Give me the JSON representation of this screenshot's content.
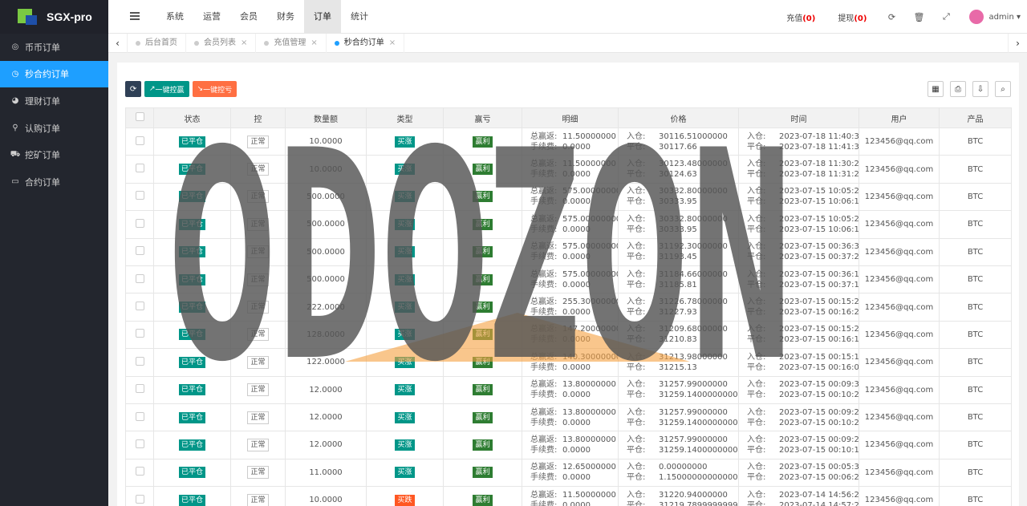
{
  "app": {
    "brand": "SGX-pro"
  },
  "sidebar": {
    "items": [
      {
        "label": "币币订单",
        "icon": "coin-icon"
      },
      {
        "label": "秒合约订单",
        "icon": "clock-icon",
        "active": true
      },
      {
        "label": "理财订单",
        "icon": "pie-icon"
      },
      {
        "label": "认购订单",
        "icon": "walk-icon"
      },
      {
        "label": "挖矿订单",
        "icon": "car-icon"
      },
      {
        "label": "合约订单",
        "icon": "monitor-icon"
      }
    ]
  },
  "header": {
    "menu": [
      "系统",
      "运营",
      "会员",
      "财务",
      "订单",
      "统计"
    ],
    "active_menu": "订单",
    "recharge_label": "充值",
    "recharge_count": "(0)",
    "withdraw_label": "提现",
    "withdraw_count": "(0)",
    "user": "admin"
  },
  "tabs": [
    {
      "label": "后台首页",
      "closable": false
    },
    {
      "label": "会员列表",
      "closable": true
    },
    {
      "label": "充值管理",
      "closable": true
    },
    {
      "label": "秒合约订单",
      "closable": true,
      "active": true
    }
  ],
  "toolbar": {
    "refresh_icon": "⟳",
    "win_label": "一键控赢",
    "lose_label": "一键控亏"
  },
  "table": {
    "columns": [
      "状态",
      "控",
      "数量额",
      "类型",
      "赢亏",
      "明细",
      "价格",
      "时间",
      "用户",
      "产品"
    ],
    "detail_keys": {
      "profit": "总赢返:",
      "fee": "手续费:"
    },
    "price_keys": {
      "in": "入仓:",
      "out": "平仓:"
    },
    "time_keys": {
      "in": "入仓:",
      "out": "平仓:"
    },
    "rows": [
      {
        "status": "已平仓",
        "ctrl": "正常",
        "amount": "10.0000",
        "type": "买涨",
        "result": "赢利",
        "profit": "11.50000000",
        "fee": "0.0000",
        "in_price": "30116.51000000",
        "out_price": "30117.66",
        "in_time": "2023-07-18 11:40:32",
        "out_time": "2023-07-18 11:41:35",
        "user": "123456@qq.com",
        "product": "BTC"
      },
      {
        "status": "已平仓",
        "ctrl": "正常",
        "amount": "10.0000",
        "type": "买涨",
        "result": "赢利",
        "profit": "11.50000000",
        "fee": "0.0000",
        "in_price": "30123.48000000",
        "out_price": "30124.63",
        "in_time": "2023-07-18 11:30:26",
        "out_time": "2023-07-18 11:31:28",
        "user": "123456@qq.com",
        "product": "BTC"
      },
      {
        "status": "已平仓",
        "ctrl": "正常",
        "amount": "500.0000",
        "type": "买涨",
        "result": "赢利",
        "profit": "575.00000000",
        "fee": "0.0000",
        "in_price": "30332.80000000",
        "out_price": "30333.95",
        "in_time": "2023-07-15 10:05:25",
        "out_time": "2023-07-15 10:06:17",
        "user": "123456@qq.com",
        "product": "BTC"
      },
      {
        "status": "已平仓",
        "ctrl": "正常",
        "amount": "500.0000",
        "type": "买涨",
        "result": "赢利",
        "profit": "575.00000000",
        "fee": "0.0000",
        "in_price": "30332.80000000",
        "out_price": "30333.95",
        "in_time": "2023-07-15 10:05:22",
        "out_time": "2023-07-15 10:06:15",
        "user": "123456@qq.com",
        "product": "BTC"
      },
      {
        "status": "已平仓",
        "ctrl": "正常",
        "amount": "500.0000",
        "type": "买涨",
        "result": "赢利",
        "profit": "575.00000000",
        "fee": "0.0000",
        "in_price": "31192.30000000",
        "out_price": "31193.45",
        "in_time": "2023-07-15 00:36:30",
        "out_time": "2023-07-15 00:37:25",
        "user": "123456@qq.com",
        "product": "BTC"
      },
      {
        "status": "已平仓",
        "ctrl": "正常",
        "amount": "500.0000",
        "type": "买涨",
        "result": "赢利",
        "profit": "575.00000000",
        "fee": "0.0000",
        "in_price": "31184.66000000",
        "out_price": "31185.81",
        "in_time": "2023-07-15 00:36:19",
        "out_time": "2023-07-15 00:37:13",
        "user": "123456@qq.com",
        "product": "BTC"
      },
      {
        "status": "已平仓",
        "ctrl": "正常",
        "amount": "222.0000",
        "type": "买涨",
        "result": "赢利",
        "profit": "255.30000000",
        "fee": "0.0000",
        "in_price": "31226.78000000",
        "out_price": "31227.93",
        "in_time": "2023-07-15 00:15:29",
        "out_time": "2023-07-15 00:16:21",
        "user": "123456@qq.com",
        "product": "BTC"
      },
      {
        "status": "已平仓",
        "ctrl": "正常",
        "amount": "128.0000",
        "type": "买涨",
        "result": "赢利",
        "profit": "147.20000000",
        "fee": "0.0000",
        "in_price": "31209.68000000",
        "out_price": "31210.83",
        "in_time": "2023-07-15 00:15:22",
        "out_time": "2023-07-15 00:16:17",
        "user": "123456@qq.com",
        "product": "BTC"
      },
      {
        "status": "已平仓",
        "ctrl": "正常",
        "amount": "122.0000",
        "type": "买涨",
        "result": "赢利",
        "profit": "140.30000000",
        "fee": "0.0000",
        "in_price": "31213.98000000",
        "out_price": "31215.13",
        "in_time": "2023-07-15 00:15:15",
        "out_time": "2023-07-15 00:16:07",
        "user": "123456@qq.com",
        "product": "BTC"
      },
      {
        "status": "已平仓",
        "ctrl": "正常",
        "amount": "12.0000",
        "type": "买涨",
        "result": "赢利",
        "profit": "13.80000000",
        "fee": "0.0000",
        "in_price": "31257.99000000",
        "out_price": "31259.14000000000",
        "in_time": "2023-07-15 00:09:30",
        "out_time": "2023-07-15 00:10:25",
        "user": "123456@qq.com",
        "product": "BTC"
      },
      {
        "status": "已平仓",
        "ctrl": "正常",
        "amount": "12.0000",
        "type": "买涨",
        "result": "赢利",
        "profit": "13.80000000",
        "fee": "0.0000",
        "in_price": "31257.99000000",
        "out_price": "31259.14000000000",
        "in_time": "2023-07-15 00:09:28",
        "out_time": "2023-07-15 00:10:21",
        "user": "123456@qq.com",
        "product": "BTC"
      },
      {
        "status": "已平仓",
        "ctrl": "正常",
        "amount": "12.0000",
        "type": "买涨",
        "result": "赢利",
        "profit": "13.80000000",
        "fee": "0.0000",
        "in_price": "31257.99000000",
        "out_price": "31259.14000000000",
        "in_time": "2023-07-15 00:09:25",
        "out_time": "2023-07-15 00:10:17",
        "user": "123456@qq.com",
        "product": "BTC"
      },
      {
        "status": "已平仓",
        "ctrl": "正常",
        "amount": "11.0000",
        "type": "买涨",
        "result": "赢利",
        "profit": "12.65000000",
        "fee": "0.0000",
        "in_price": "0.00000000",
        "out_price": "1.15000000000000",
        "in_time": "2023-07-15 00:05:32",
        "out_time": "2023-07-15 00:06:26",
        "user": "123456@qq.com",
        "product": "BTC"
      },
      {
        "status": "已平仓",
        "ctrl": "正常",
        "amount": "10.0000",
        "type": "买跌",
        "result": "赢利",
        "profit": "11.50000000",
        "fee": "0.0000",
        "in_price": "31220.94000000",
        "out_price": "31219.78999999999",
        "in_time": "2023-07-14 14:56:29",
        "out_time": "2023-07-14 14:57:22",
        "user": "123456@qq.com",
        "product": "BTC"
      }
    ]
  },
  "watermark": {
    "text": "ODOZON",
    "color": "#555555",
    "triangle_color": "#f5a040"
  },
  "colors": {
    "accent": "#1e9fff",
    "green": "#009688",
    "red": "#ff5722",
    "sidebar": "#23262e"
  }
}
